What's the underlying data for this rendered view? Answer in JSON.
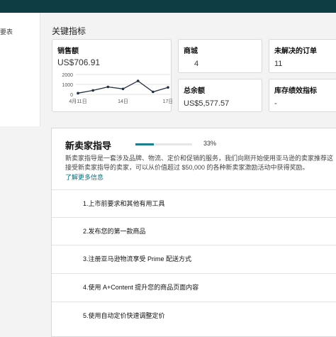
{
  "sidebar": {
    "label": "要表"
  },
  "metrics": {
    "title": "关键指标",
    "sales": {
      "label": "销售额",
      "value": "US$706.91"
    },
    "products": {
      "label": "商城",
      "value": "4"
    },
    "orders": {
      "label": "未解决的订单",
      "value": "11"
    },
    "balance": {
      "label": "总余额",
      "value": "US$5,577.57"
    },
    "inventory": {
      "label": "库存绩效指标",
      "value": "-"
    }
  },
  "chart_data": {
    "type": "line",
    "x": [
      "4月11日",
      "",
      "",
      "14日",
      "",
      "",
      "17日"
    ],
    "values": [
      120,
      400,
      750,
      550,
      1350,
      250,
      700
    ],
    "ylim": [
      0,
      2000
    ],
    "yticks": [
      "0",
      "1000",
      "2000"
    ],
    "xticks": [
      "4月11日",
      "14日",
      "17日"
    ],
    "grid": true,
    "color": "#232f3e"
  },
  "guide": {
    "title": "新卖家指导",
    "progress": 0.33,
    "progress_text": "33%",
    "desc_line1": "新卖家指导是一套涉及品牌、物流、定价和促销的服务，我们向刚开始使用亚马逊的卖家推荐这",
    "desc_line2": "接受新卖家指导的卖家，可以从价值超过 $50,000 的各种新卖家激励活动中获得奖励。",
    "link": "了解更多信息",
    "steps": [
      "1.上市前要求和其他有用工具",
      "2.发布您的第一款商品",
      "3.注册亚马逊物流享受 Prime 配送方式",
      "4.使用 A+Content 提升您的商品页面内容",
      "5.使用自动定价快速调整定价"
    ]
  },
  "colors": {
    "topbar": "#0f3d44",
    "accent": "#1b7f8f",
    "link": "#007185"
  }
}
